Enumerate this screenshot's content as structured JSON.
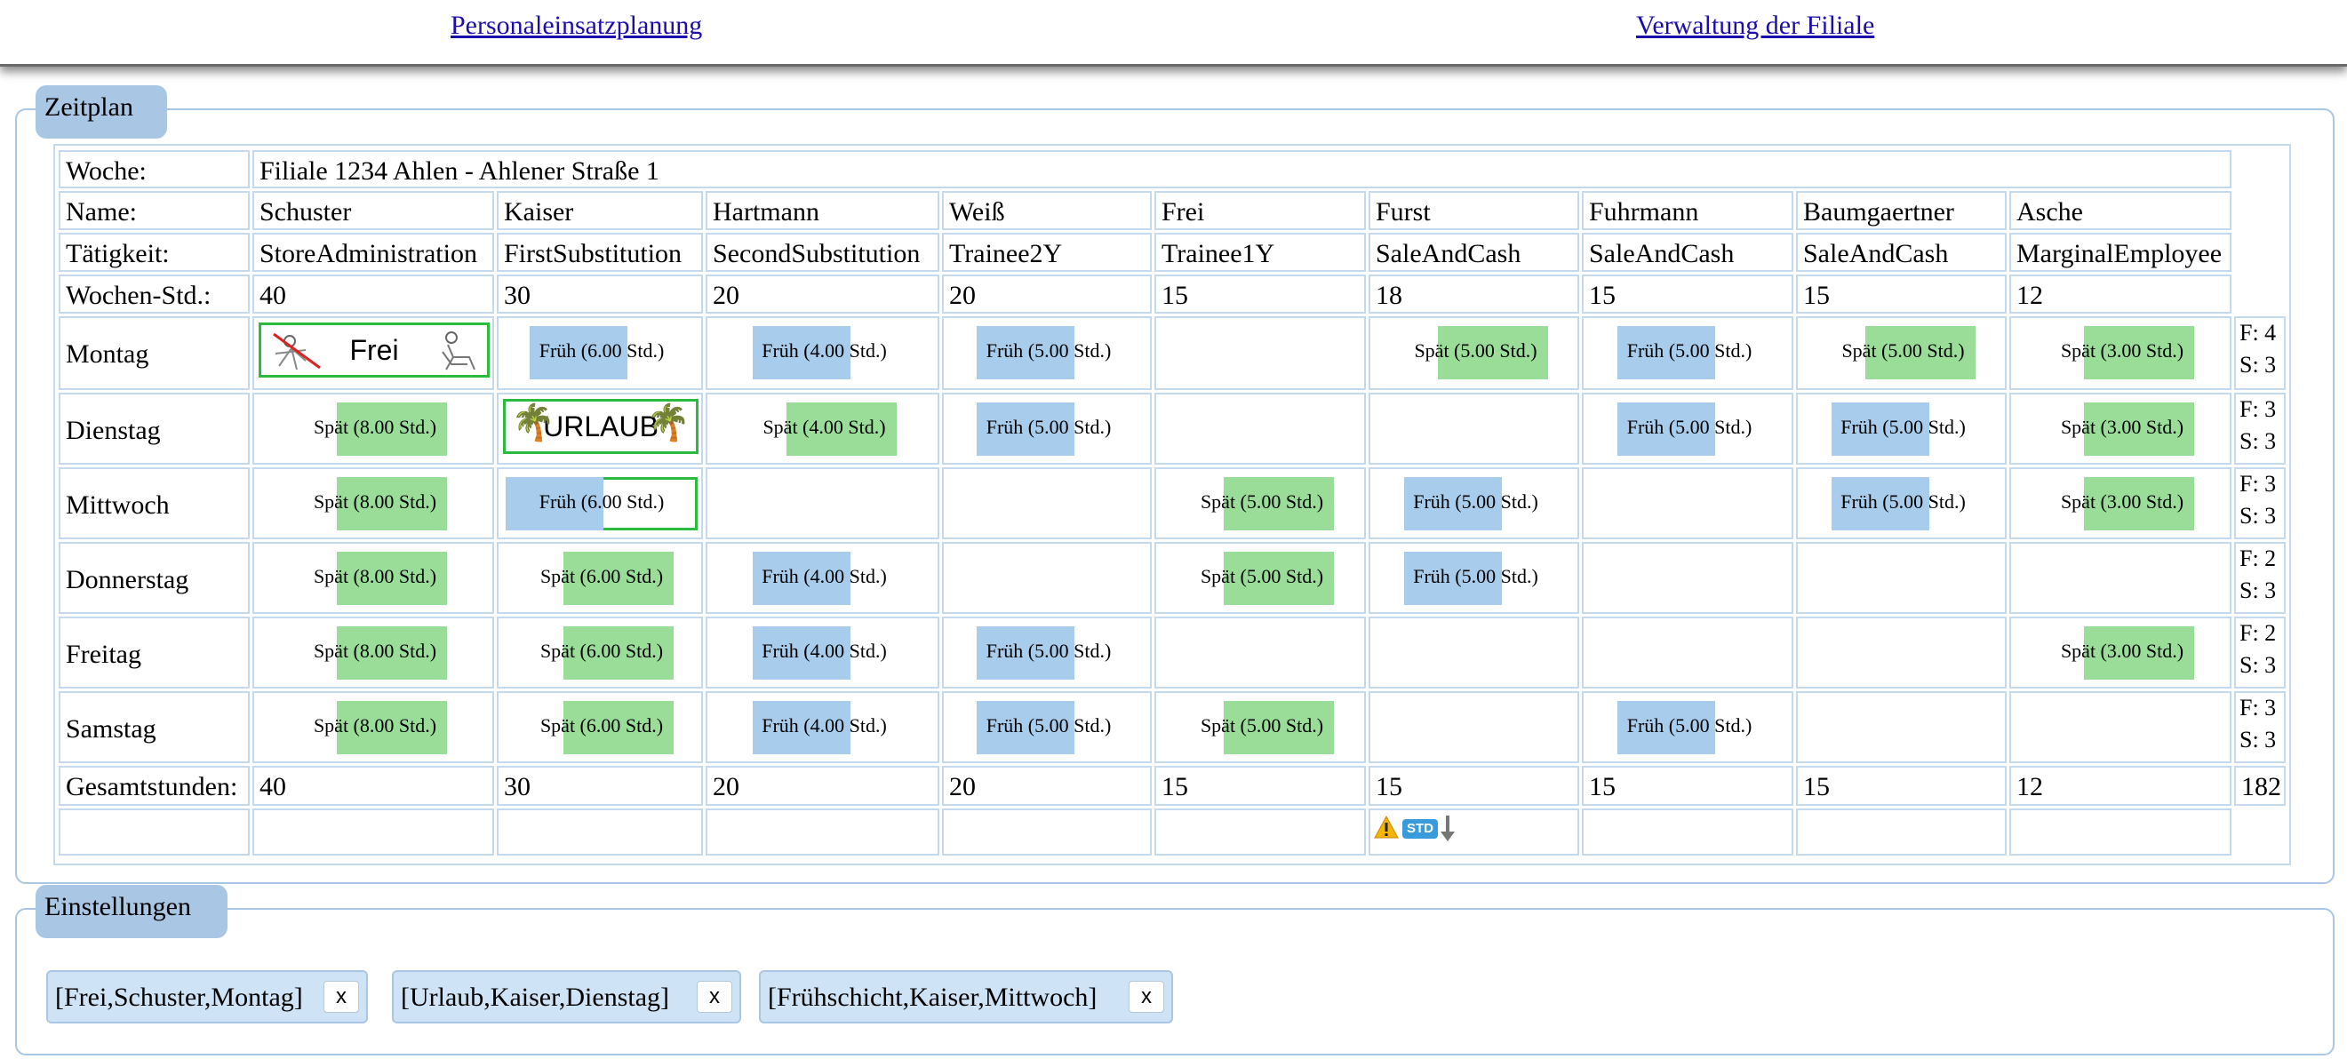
{
  "nav": {
    "personal": "Personaleinsatzplanung",
    "filiale": "Verwaltung der Filiale"
  },
  "zeitplan": {
    "legend": "Zeitplan",
    "woche_label": "Woche:",
    "woche_value": "Filiale 1234 Ahlen - Ahlener Straße 1",
    "name_label": "Name:",
    "taetigkeit_label": "Tätigkeit:",
    "wochenstd_label": "Wochen-Std.:",
    "gesamt_label": "Gesamtstunden:",
    "employees": [
      {
        "name": "Schuster",
        "role": "StoreAdministration",
        "weekly": "40",
        "total": "40"
      },
      {
        "name": "Kaiser",
        "role": "FirstSubstitution",
        "weekly": "30",
        "total": "30"
      },
      {
        "name": "Hartmann",
        "role": "SecondSubstitution",
        "weekly": "20",
        "total": "20"
      },
      {
        "name": "Weiß",
        "role": "Trainee2Y",
        "weekly": "20",
        "total": "20"
      },
      {
        "name": "Frei",
        "role": "Trainee1Y",
        "weekly": "15",
        "total": "15"
      },
      {
        "name": "Furst",
        "role": "SaleAndCash",
        "weekly": "18",
        "total": "15"
      },
      {
        "name": "Fuhrmann",
        "role": "SaleAndCash",
        "weekly": "15",
        "total": "15"
      },
      {
        "name": "Baumgaertner",
        "role": "SaleAndCash",
        "weekly": "15",
        "total": "15"
      },
      {
        "name": "Asche",
        "role": "MarginalEmployee",
        "weekly": "12",
        "total": "12"
      }
    ],
    "grand_total": "182",
    "days": [
      {
        "name": "Montag",
        "summary_f": "F: 4",
        "summary_s": "S: 3",
        "cells": [
          {
            "kind": "special",
            "text": "Frei",
            "icon": "vacation-chair-icon"
          },
          {
            "kind": "fruh",
            "text": "Früh (6.00 Std.)"
          },
          {
            "kind": "fruh",
            "text": "Früh (4.00 Std.)"
          },
          {
            "kind": "fruh",
            "text": "Früh (5.00 Std.)"
          },
          {
            "kind": "empty"
          },
          {
            "kind": "spat",
            "text": "Spät (5.00 Std.)"
          },
          {
            "kind": "fruh",
            "text": "Früh (5.00 Std.)"
          },
          {
            "kind": "spat",
            "text": "Spät (5.00 Std.)"
          },
          {
            "kind": "spat",
            "text": "Spät (3.00 Std.)"
          }
        ]
      },
      {
        "name": "Dienstag",
        "summary_f": "F: 3",
        "summary_s": "S: 3",
        "cells": [
          {
            "kind": "spat",
            "text": "Spät (8.00 Std.)"
          },
          {
            "kind": "special",
            "text": "URLAUB",
            "icon": "palm-tree-icon"
          },
          {
            "kind": "spat",
            "text": "Spät (4.00 Std.)"
          },
          {
            "kind": "fruh",
            "text": "Früh (5.00 Std.)"
          },
          {
            "kind": "empty"
          },
          {
            "kind": "empty"
          },
          {
            "kind": "fruh",
            "text": "Früh (5.00 Std.)"
          },
          {
            "kind": "fruh",
            "text": "Früh (5.00 Std.)"
          },
          {
            "kind": "spat",
            "text": "Spät (3.00 Std.)"
          }
        ]
      },
      {
        "name": "Mittwoch",
        "summary_f": "F: 3",
        "summary_s": "S: 3",
        "cells": [
          {
            "kind": "spat",
            "text": "Spät (8.00 Std.)"
          },
          {
            "kind": "fruh",
            "text": "Früh (6.00 Std.)",
            "highlight": true
          },
          {
            "kind": "empty"
          },
          {
            "kind": "empty"
          },
          {
            "kind": "spat",
            "text": "Spät (5.00 Std.)"
          },
          {
            "kind": "fruh",
            "text": "Früh (5.00 Std.)"
          },
          {
            "kind": "empty"
          },
          {
            "kind": "fruh",
            "text": "Früh (5.00 Std.)"
          },
          {
            "kind": "spat",
            "text": "Spät (3.00 Std.)"
          }
        ]
      },
      {
        "name": "Donnerstag",
        "summary_f": "F: 2",
        "summary_s": "S: 3",
        "cells": [
          {
            "kind": "spat",
            "text": "Spät (8.00 Std.)"
          },
          {
            "kind": "spat",
            "text": "Spät (6.00 Std.)"
          },
          {
            "kind": "fruh",
            "text": "Früh (4.00 Std.)"
          },
          {
            "kind": "empty"
          },
          {
            "kind": "spat",
            "text": "Spät (5.00 Std.)"
          },
          {
            "kind": "fruh",
            "text": "Früh (5.00 Std.)"
          },
          {
            "kind": "empty"
          },
          {
            "kind": "empty"
          },
          {
            "kind": "empty"
          }
        ]
      },
      {
        "name": "Freitag",
        "summary_f": "F: 2",
        "summary_s": "S: 3",
        "cells": [
          {
            "kind": "spat",
            "text": "Spät (8.00 Std.)"
          },
          {
            "kind": "spat",
            "text": "Spät (6.00 Std.)"
          },
          {
            "kind": "fruh",
            "text": "Früh (4.00 Std.)"
          },
          {
            "kind": "fruh",
            "text": "Früh (5.00 Std.)"
          },
          {
            "kind": "empty"
          },
          {
            "kind": "empty"
          },
          {
            "kind": "empty"
          },
          {
            "kind": "empty"
          },
          {
            "kind": "spat",
            "text": "Spät (3.00 Std.)"
          }
        ]
      },
      {
        "name": "Samstag",
        "summary_f": "F: 3",
        "summary_s": "S: 3",
        "cells": [
          {
            "kind": "spat",
            "text": "Spät (8.00 Std.)"
          },
          {
            "kind": "spat",
            "text": "Spät (6.00 Std.)"
          },
          {
            "kind": "fruh",
            "text": "Früh (4.00 Std.)"
          },
          {
            "kind": "fruh",
            "text": "Früh (5.00 Std.)"
          },
          {
            "kind": "spat",
            "text": "Spät (5.00 Std.)"
          },
          {
            "kind": "empty"
          },
          {
            "kind": "fruh",
            "text": "Früh (5.00 Std.)"
          },
          {
            "kind": "empty"
          },
          {
            "kind": "empty"
          }
        ]
      }
    ],
    "warning": {
      "icons": [
        "warning-icon",
        "std-badge-icon",
        "arrow-down-icon"
      ],
      "badge_text": "STD",
      "employee": "Furst"
    }
  },
  "einstellungen": {
    "legend": "Einstellungen",
    "chips": [
      {
        "text": "[Frei,Schuster,Montag]",
        "remove": "x"
      },
      {
        "text": "[Urlaub,Kaiser,Dienstag]",
        "remove": "x"
      },
      {
        "text": "[Frühschicht,Kaiser,Mittwoch]",
        "remove": "x"
      }
    ]
  },
  "colors": {
    "fruh": "#a7ccec",
    "spat": "#99dd99",
    "highlight": "#2bbb3f",
    "legend_bg": "#a9c6e4",
    "border": "#c5d9ee",
    "link": "#1a0dab"
  }
}
